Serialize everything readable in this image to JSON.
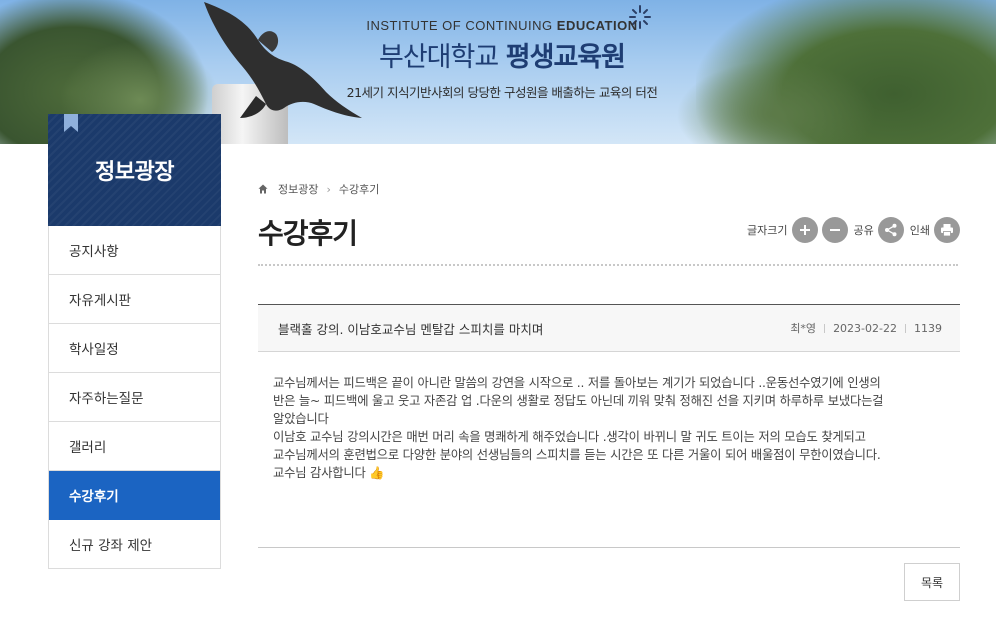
{
  "banner": {
    "en_prefix": "INSTITUTE OF CONTINUING ",
    "en_bold": "EDUCATION",
    "kr_prefix": "부산대학교 ",
    "kr_bold": "평생교육원",
    "subtitle": "21세기 지식기반사회의 당당한 구성원을 배출하는 교육의 터전"
  },
  "sidebar": {
    "title": "정보광장",
    "items": [
      {
        "label": "공지사항",
        "active": false
      },
      {
        "label": "자유게시판",
        "active": false
      },
      {
        "label": "학사일정",
        "active": false
      },
      {
        "label": "자주하는질문",
        "active": false
      },
      {
        "label": "갤러리",
        "active": false
      },
      {
        "label": "수강후기",
        "active": true
      },
      {
        "label": "신규 강좌 제안",
        "active": false
      }
    ]
  },
  "breadcrumb": {
    "home_icon": "home-icon",
    "current": "정보광장",
    "page": "수강후기"
  },
  "page": {
    "title": "수강후기"
  },
  "tools": {
    "font_size_label": "글자크기",
    "share_label": "공유",
    "print_label": "인쇄"
  },
  "post": {
    "title": "블랙홀 강의. 이남호교수님 멘탈갑 스피치를 마치며",
    "author": "최*영",
    "date": "2023-02-22",
    "views": "1139",
    "body": [
      "교수님께서는  피드백은 끝이 아니란 말씀의 강연을 시작으로 .. 저를 돌아보는 계기가 되었습니다 ..운동선수였기에  인생의",
      "반은 늘~  피드백에 울고 웃고 자존감  업 .다운의 생활로 정답도 아닌데 끼워 맞춰 정해진 선을 지키며 하루하루 보냈다는걸",
      "알았습니다",
      "이남호 교수님 강의시간은 매번  머리 속을 명쾌하게 해주었습니다  .생각이 바뀌니  말 귀도 트이는 저의 모습도 찾게되고",
      "교수님께서의 훈련법으로  다양한 분야의 선생님들의 스피치를 듣는 시간은 또 다른 거울이 되어 배울점이 무한이였습니다.",
      "교수님 감사합니다 👍"
    ]
  },
  "list_button": {
    "label": "목록"
  },
  "colors": {
    "nav_dark": "#1b3a6b",
    "nav_active": "#1b64c2",
    "tool_btn": "#999999"
  }
}
